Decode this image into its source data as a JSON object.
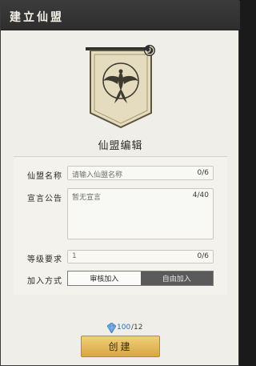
{
  "window": {
    "title": "建立仙盟"
  },
  "banner": {
    "emblem": "phoenix-emblem",
    "corner_icon": "swirl-icon"
  },
  "section": {
    "title": "仙盟编辑"
  },
  "form": {
    "name": {
      "label": "仙盟名称",
      "placeholder": "请输入仙盟名称",
      "count": "0/6"
    },
    "manifesto": {
      "label": "宣言公告",
      "value": "暂无宣言",
      "count": "4/40"
    },
    "level": {
      "label": "等级要求",
      "value": "1",
      "count": "0/6"
    },
    "join": {
      "label": "加入方式",
      "options": [
        {
          "label": "审核加入",
          "selected": true
        },
        {
          "label": "自由加入",
          "selected": false
        }
      ]
    }
  },
  "cost": {
    "icon": "gem-icon",
    "value": "100",
    "max": "/12"
  },
  "actions": {
    "create_label": "创建"
  },
  "colors": {
    "accent_gold": "#d7a741",
    "panel_bg": "#efeee8",
    "title_bg": "#333333"
  }
}
